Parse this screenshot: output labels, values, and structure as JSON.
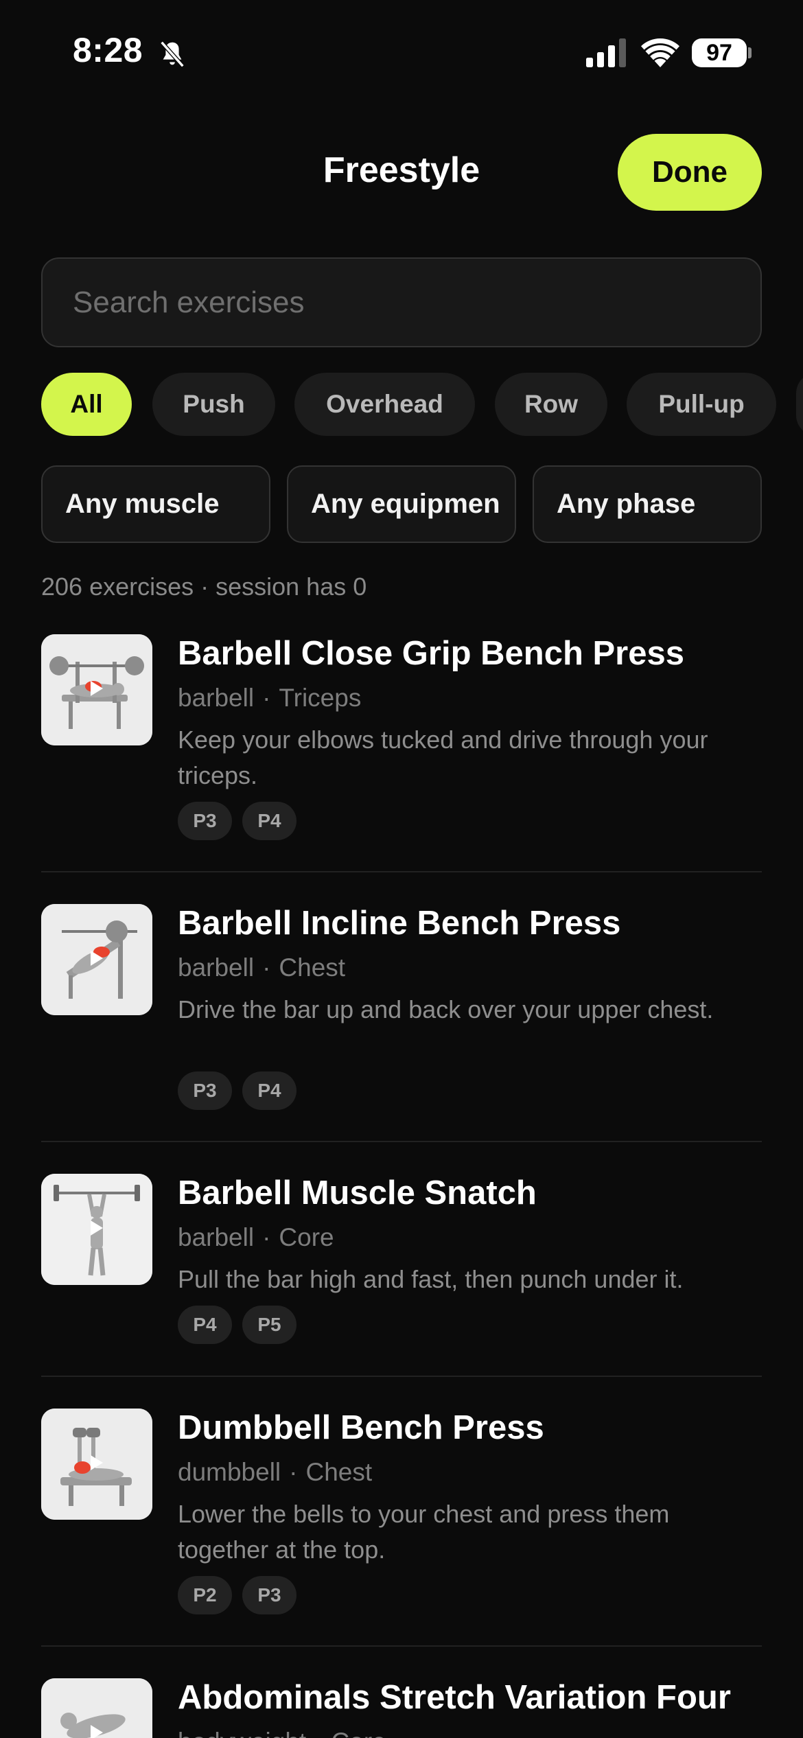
{
  "status_bar": {
    "time": "8:28",
    "battery": "97",
    "icons": [
      "bell-slash-icon",
      "cellular-signal-icon",
      "wifi-icon",
      "battery-icon"
    ]
  },
  "header": {
    "title": "Freestyle",
    "done_label": "Done"
  },
  "search": {
    "placeholder": "Search exercises",
    "value": ""
  },
  "categories": [
    {
      "label": "All",
      "active": true
    },
    {
      "label": "Push",
      "active": false
    },
    {
      "label": "Overhead",
      "active": false
    },
    {
      "label": "Row",
      "active": false
    },
    {
      "label": "Pull-up",
      "active": false
    }
  ],
  "filters": {
    "muscle": "Any muscle",
    "equipment": "Any equipmen",
    "phase": "Any phase"
  },
  "summary": "206 exercises · session has 0",
  "exercises": [
    {
      "name": "Barbell Close Grip Bench Press",
      "equipment": "barbell",
      "muscle": "Triceps",
      "cue": "Keep your elbows tucked and drive through your triceps.",
      "phases": [
        "P3",
        "P4"
      ]
    },
    {
      "name": "Barbell Incline Bench Press",
      "equipment": "barbell",
      "muscle": "Chest",
      "cue": "Drive the bar up and back over your upper chest.",
      "phases": [
        "P3",
        "P4"
      ]
    },
    {
      "name": "Barbell Muscle Snatch",
      "equipment": "barbell",
      "muscle": "Core",
      "cue": "Pull the bar high and fast, then punch under it.",
      "phases": [
        "P4",
        "P5"
      ]
    },
    {
      "name": "Dumbbell Bench Press",
      "equipment": "dumbbell",
      "muscle": "Chest",
      "cue": "Lower the bells to your chest and press them together at the top.",
      "phases": [
        "P2",
        "P3"
      ]
    },
    {
      "name": "Abdominals Stretch Variation Four",
      "equipment": "bodyweight",
      "muscle": "Core",
      "cue": "",
      "phases": []
    }
  ],
  "meta_separator": "·",
  "colors": {
    "accent": "#d3f54c",
    "background": "#0b0b0b",
    "chip": "#1c1c1c",
    "muscle_highlight": "#e8432e"
  }
}
